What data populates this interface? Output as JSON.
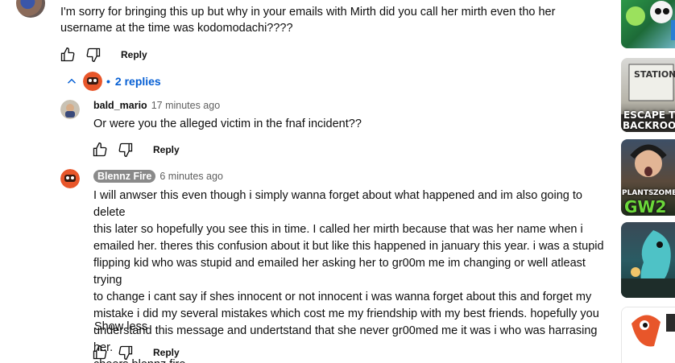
{
  "top_comment": {
    "text": "I'm sorry for bringing this up but why in your emails with Mirth did you call her mirth even tho her username at the time was kodomodachi????",
    "reply_label": "Reply"
  },
  "replies_toggle": {
    "dot": "•",
    "label": "2 replies"
  },
  "replies": [
    {
      "author": "bald_mario",
      "time": "17 minutes ago",
      "text": "Or were you the alleged victim in the fnaf incident??",
      "reply_label": "Reply"
    },
    {
      "author": "Blennz Fire",
      "time": "6 minutes ago",
      "text": "I will anwser this even though i simply wanna forget about what happened and im also going to delete\nthis later so hopefully you see this in time. I called her mirth because that was her name when i\nemailed her. theres this confusion about it but like this happened in january this year. i was a stupid\nflipping kid who was stupid and emailed her asking her to gr00m me im changing or well atleast trying\nto change i cant say if shes innocent or not innocent i was wanna forget about this and forget my\nmistake i did my several mistakes which cost me my friendship with my best friends. hopefully you\nunderstand this message and undertstand that she never gr00med me it was i who was harrasing her.\ncheers blennz fire.",
      "show_less": "Show less",
      "reply_label": "Reply"
    }
  ],
  "sidebar": {
    "thumb2_caption_a": "STATION",
    "thumb2_caption_b": "ESCAPE TH",
    "thumb2_caption_c": "BACKROOM",
    "thumb3_caption_a": "PLANTS",
    "thumb3_caption_b": "ZOMBIES",
    "thumb3_caption_c": "GW2"
  },
  "colors": {
    "link": "#065fd4",
    "text": "#0f0f0f",
    "muted": "#606060",
    "badge_bg": "#8a8a8a"
  }
}
